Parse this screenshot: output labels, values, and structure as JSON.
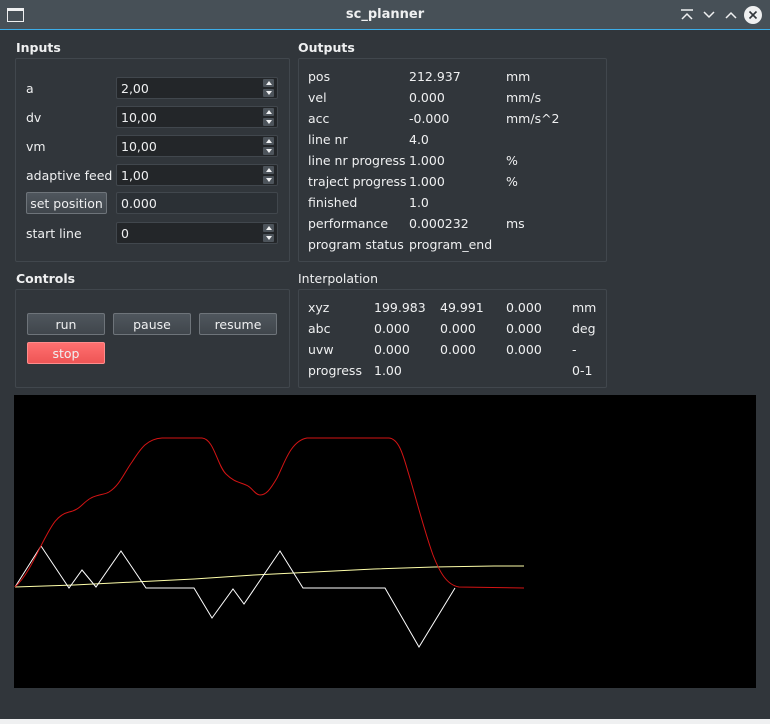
{
  "window": {
    "title": "sc_planner"
  },
  "inputs": {
    "title": "Inputs",
    "rows": [
      {
        "label": "a",
        "value": "2,00"
      },
      {
        "label": "dv",
        "value": "10,00"
      },
      {
        "label": "vm",
        "value": "10,00"
      },
      {
        "label": "adaptive feed",
        "value": "1,00"
      }
    ],
    "set_position_label": "set position",
    "set_position_value": "0.000",
    "start_line_label": "start line",
    "start_line_value": "0"
  },
  "outputs": {
    "title": "Outputs",
    "rows": [
      {
        "label": "pos",
        "value": "212.937",
        "unit": "mm"
      },
      {
        "label": "vel",
        "value": "0.000",
        "unit": "mm/s"
      },
      {
        "label": "acc",
        "value": "-0.000",
        "unit": "mm/s^2"
      },
      {
        "label": "line nr",
        "value": "4.0",
        "unit": ""
      },
      {
        "label": "line nr progress",
        "value": "1.000",
        "unit": "%"
      },
      {
        "label": "traject progress",
        "value": "1.000",
        "unit": "%"
      },
      {
        "label": "finished",
        "value": "1.0",
        "unit": ""
      },
      {
        "label": "performance",
        "value": "0.000232",
        "unit": "ms"
      },
      {
        "label": "program status",
        "value": "program_end",
        "unit": ""
      }
    ]
  },
  "controls": {
    "title": "Controls",
    "run": "run",
    "pause": "pause",
    "resume": "resume",
    "stop": "stop"
  },
  "interpolation": {
    "title": "Interpolation",
    "rows": [
      {
        "label": "xyz",
        "v1": "199.983",
        "v2": "49.991",
        "v3": "0.000",
        "unit": "mm"
      },
      {
        "label": "abc",
        "v1": "0.000",
        "v2": "0.000",
        "v3": "0.000",
        "unit": "deg"
      },
      {
        "label": "uvw",
        "v1": "0.000",
        "v2": "0.000",
        "v3": "0.000",
        "unit": "-"
      },
      {
        "label": "progress",
        "v1": "1.00",
        "v2": "",
        "v3": "",
        "unit": "0-1"
      }
    ]
  },
  "plot": {
    "colors": {
      "background": "#000000",
      "position": "#e02020",
      "velocity": "#ffffff",
      "progress": "#ffffaa"
    }
  },
  "theme": {
    "accent": "#3daee9",
    "stop": "#ff6b6b"
  }
}
